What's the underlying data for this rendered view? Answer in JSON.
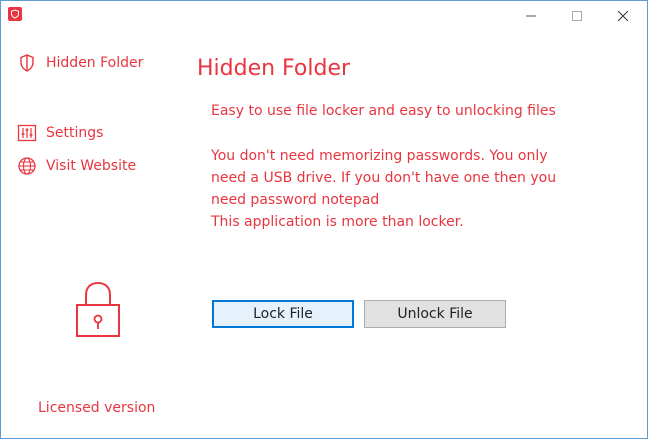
{
  "window": {
    "app_icon": "shield-icon",
    "controls": [
      "minimize-icon",
      "maximize-icon",
      "close-icon"
    ]
  },
  "sidebar": {
    "items": [
      {
        "label": "Hidden Folder",
        "icon": "shield-icon"
      },
      {
        "label": "Settings",
        "icon": "sliders-icon"
      },
      {
        "label": "Visit Website",
        "icon": "globe-icon"
      }
    ],
    "lock_icon": "padlock-icon",
    "license": "Licensed version"
  },
  "main": {
    "title": "Hidden Folder",
    "tagline": "Easy to use file locker and easy to unlocking files",
    "description_lines": [
      "You don't need memorizing passwords. You only",
      "need a USB drive. If you don't have one then you",
      "need password notepad",
      "This application is more than locker."
    ],
    "lock_button": "Lock File",
    "unlock_button": "Unlock File"
  },
  "colors": {
    "accent": "#e8353f",
    "focus_border": "#0078d7",
    "button_bg": "#e1e1e1"
  }
}
